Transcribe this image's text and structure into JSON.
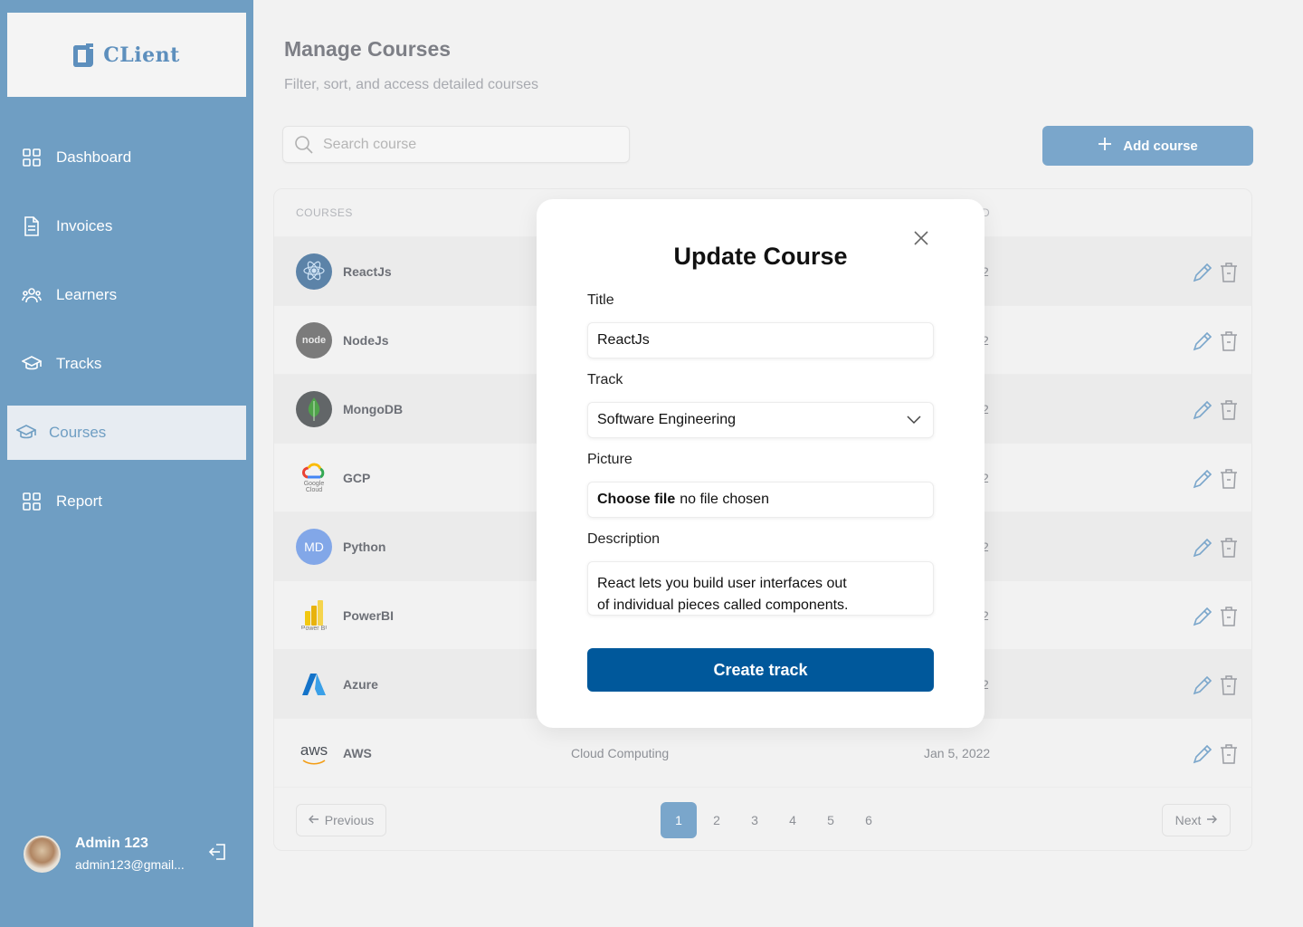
{
  "brand": {
    "logo_text": "CLient"
  },
  "sidebar": {
    "items": [
      {
        "label": "Dashboard",
        "icon": "grid-icon"
      },
      {
        "label": "Invoices",
        "icon": "document-icon"
      },
      {
        "label": "Learners",
        "icon": "users-icon"
      },
      {
        "label": "Tracks",
        "icon": "graduation-cap-icon"
      },
      {
        "label": "Courses",
        "icon": "graduation-cap-icon",
        "active": true
      },
      {
        "label": "Report",
        "icon": "grid-icon"
      }
    ],
    "user": {
      "name": "Admin 123",
      "email": "admin123@gmail..."
    }
  },
  "page": {
    "title": "Manage Courses",
    "subtitle": "Filter, sort, and access detailed courses"
  },
  "search": {
    "placeholder": "Search course"
  },
  "add_button": {
    "label": "Add course"
  },
  "table": {
    "headers": {
      "courses": "COURSES",
      "joined_partial": "D"
    },
    "rows": [
      {
        "name": "ReactJs",
        "date_partial": "2",
        "logo": "react-logo"
      },
      {
        "name": "NodeJs",
        "date_partial": "2",
        "logo": "node-logo"
      },
      {
        "name": "MongoDB",
        "date_partial": "2",
        "logo": "mongodb-logo"
      },
      {
        "name": "GCP",
        "date_partial": "2",
        "logo": "google-cloud-logo"
      },
      {
        "name": "Python",
        "date_partial": "2",
        "logo_initials": "MD"
      },
      {
        "name": "PowerBI",
        "date_partial": "2",
        "logo": "powerbi-logo"
      },
      {
        "name": "Azure",
        "date_partial": "2",
        "logo": "azure-logo"
      },
      {
        "name": "AWS",
        "track": "Cloud Computing",
        "date": "Jan 5, 2022",
        "logo": "aws-logo"
      }
    ],
    "logo_captions": {
      "react": "ReactJS",
      "node": "node",
      "google": "Google Cloud",
      "powerbi": "Power BI",
      "aws": "aws"
    }
  },
  "pagination": {
    "previous": "Previous",
    "next": "Next",
    "pages": [
      "1",
      "2",
      "3",
      "4",
      "5",
      "6"
    ],
    "current": "1"
  },
  "modal": {
    "title": "Update Course",
    "title_label": "Title",
    "title_value": "ReactJs",
    "track_label": "Track",
    "track_value": "Software Engineering",
    "picture_label": "Picture",
    "file_button": "Choose file",
    "file_status": "no file chosen",
    "description_label": "Description",
    "description_line1": "React lets you build user interfaces out",
    "description_line2": "of individual pieces called components.",
    "submit_label": "Create track"
  },
  "colors": {
    "sidebar_bg": "#6f9ec3",
    "accent": "#7aa6cb",
    "primary_button": "#00589b"
  }
}
